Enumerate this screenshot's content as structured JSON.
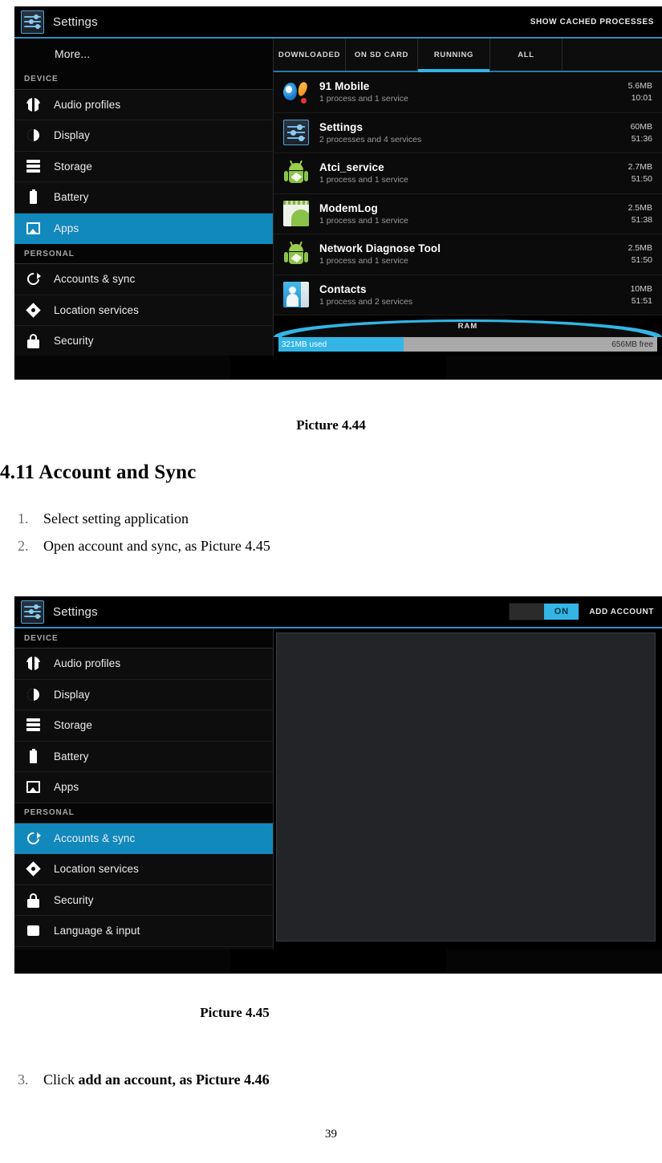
{
  "document": {
    "caption_444": "Picture 4.44",
    "caption_445": "Picture 4.45",
    "section_heading": "4.11 Account and Sync",
    "steps": [
      {
        "num": "1.",
        "text": "Select setting application",
        "bold_part": ""
      },
      {
        "num": "2.",
        "text": "Open account and sync, as Picture 4.45",
        "bold_part": ""
      }
    ],
    "step3": {
      "num": "3.",
      "lead": "Click ",
      "bold": "add an account, as Picture 4.46"
    },
    "page_number": "39"
  },
  "colors": {
    "accent_blue": "#33b5e5",
    "selected_row": "#1189bd",
    "tab_underline": "#33b5e5",
    "ram_used": "#33b5e5",
    "ram_free": "#a9a9a9",
    "screen_black": "#000000"
  },
  "screenshot_apps": {
    "action_bar": {
      "icon": "settings-app-icon",
      "title": "Settings",
      "right_button": "SHOW CACHED PROCESSES"
    },
    "sidebar": {
      "items": [
        {
          "label": "More...",
          "icon": "none",
          "type": "plain",
          "selected": false
        },
        {
          "label": "DEVICE",
          "type": "header"
        },
        {
          "label": "Audio profiles",
          "icon": "audio-profiles-icon",
          "type": "row",
          "selected": false
        },
        {
          "label": "Display",
          "icon": "display-icon",
          "type": "row",
          "selected": false
        },
        {
          "label": "Storage",
          "icon": "storage-icon",
          "type": "row",
          "selected": false
        },
        {
          "label": "Battery",
          "icon": "battery-icon",
          "type": "row",
          "selected": false
        },
        {
          "label": "Apps",
          "icon": "apps-icon",
          "type": "row",
          "selected": true
        },
        {
          "label": "PERSONAL",
          "type": "header"
        },
        {
          "label": "Accounts & sync",
          "icon": "sync-icon",
          "type": "row",
          "selected": false
        },
        {
          "label": "Location services",
          "icon": "location-icon",
          "type": "row",
          "selected": false
        },
        {
          "label": "Security",
          "icon": "security-icon",
          "type": "row",
          "selected": false
        }
      ]
    },
    "tabs": [
      {
        "label": "DOWNLOADED",
        "active": false
      },
      {
        "label": "ON SD CARD",
        "active": false
      },
      {
        "label": "RUNNING",
        "active": true
      },
      {
        "label": "ALL",
        "active": false
      }
    ],
    "processes": [
      {
        "name": "91 Mobile",
        "sub": "1 process and 1 service",
        "size": "5.6MB",
        "time": "10:01",
        "icon": "app-91-mobile-icon"
      },
      {
        "name": "Settings",
        "sub": "2 processes and 4 services",
        "size": "60MB",
        "time": "51:36",
        "icon": "settings-app-icon"
      },
      {
        "name": "Atci_service",
        "sub": "1 process and 1 service",
        "size": "2.7MB",
        "time": "51:50",
        "icon": "android-robot-icon"
      },
      {
        "name": "ModemLog",
        "sub": "1 process and 1 service",
        "size": "2.5MB",
        "time": "51:38",
        "icon": "modemlog-icon"
      },
      {
        "name": "Network Diagnose Tool",
        "sub": "1 process and 1 service",
        "size": "2.5MB",
        "time": "51:50",
        "icon": "android-robot-icon"
      },
      {
        "name": "Contacts",
        "sub": "1 process and 2 services",
        "size": "10MB",
        "time": "51:51",
        "icon": "contacts-icon"
      }
    ],
    "ram": {
      "label": "RAM",
      "used": "321MB used",
      "free": "656MB free",
      "used_percent": 33
    }
  },
  "screenshot_accounts": {
    "action_bar": {
      "icon": "settings-app-icon",
      "title": "Settings",
      "toggle_label": "ON",
      "toggle_state": "on",
      "right_button": "ADD ACCOUNT"
    },
    "sidebar": {
      "items": [
        {
          "label": "DEVICE",
          "type": "header"
        },
        {
          "label": "Audio profiles",
          "icon": "audio-profiles-icon",
          "type": "row",
          "selected": false
        },
        {
          "label": "Display",
          "icon": "display-icon",
          "type": "row",
          "selected": false
        },
        {
          "label": "Storage",
          "icon": "storage-icon",
          "type": "row",
          "selected": false
        },
        {
          "label": "Battery",
          "icon": "battery-icon",
          "type": "row",
          "selected": false
        },
        {
          "label": "Apps",
          "icon": "apps-icon",
          "type": "row",
          "selected": false
        },
        {
          "label": "PERSONAL",
          "type": "header"
        },
        {
          "label": "Accounts & sync",
          "icon": "sync-icon",
          "type": "row",
          "selected": true
        },
        {
          "label": "Location services",
          "icon": "location-icon",
          "type": "row",
          "selected": false
        },
        {
          "label": "Security",
          "icon": "security-icon",
          "type": "row",
          "selected": false
        },
        {
          "label": "Language & input",
          "icon": "language-icon",
          "type": "row",
          "selected": false
        }
      ]
    },
    "content": {
      "empty": true
    }
  }
}
